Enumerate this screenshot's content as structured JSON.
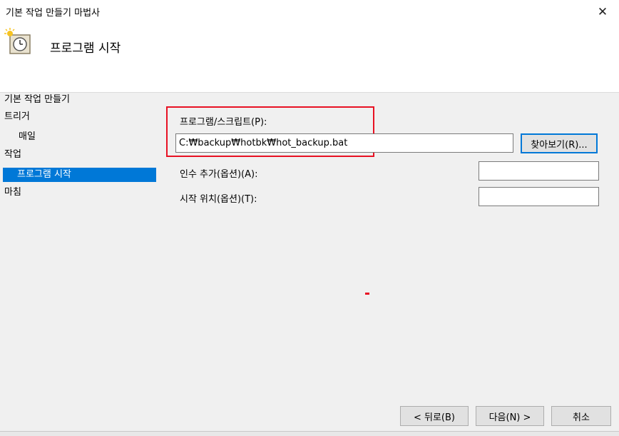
{
  "window": {
    "title": "기본 작업 만들기 마법사",
    "close_glyph": "✕"
  },
  "header": {
    "title": "프로그램 시작",
    "icon": "task-clock-icon"
  },
  "nav": {
    "items": [
      {
        "label": "기본 작업 만들기",
        "selected": false
      },
      {
        "label": "트리거",
        "selected": false
      },
      {
        "label": "매일",
        "selected": false
      },
      {
        "label": "작업",
        "selected": false
      },
      {
        "label": "프로그램 시작",
        "selected": true
      },
      {
        "label": "마침",
        "selected": false
      }
    ]
  },
  "form": {
    "program_label": "프로그램/스크립트(P):",
    "program_value": "C:₩backup₩hotbk₩hot_backup.bat",
    "browse_label": "찾아보기(R)...",
    "args_label": "인수 추가(옵션)(A):",
    "args_value": "",
    "startin_label": "시작 위치(옵션)(T):",
    "startin_value": ""
  },
  "footer": {
    "back_label": "< 뒤로(B)",
    "next_label": "다음(N) >",
    "cancel_label": "취소"
  },
  "colors": {
    "selection": "#0078d7",
    "highlight": "#e81123"
  }
}
